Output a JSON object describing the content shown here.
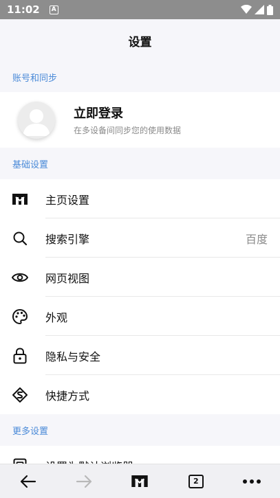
{
  "status_bar": {
    "time": "11:02",
    "notification_letter": "A"
  },
  "app_bar": {
    "title": "设置"
  },
  "sections": {
    "account": {
      "header": "账号和同步",
      "login": "立即登录",
      "subtitle": "在多设备间同步您的使用数据"
    },
    "basic": {
      "header": "基础设置",
      "items": [
        {
          "label": "主页设置",
          "value": "",
          "icon": "home-logo-icon"
        },
        {
          "label": "搜索引擎",
          "value": "百度",
          "icon": "search-icon"
        },
        {
          "label": "网页视图",
          "value": "",
          "icon": "eye-icon"
        },
        {
          "label": "外观",
          "value": "",
          "icon": "palette-icon"
        },
        {
          "label": "隐私与安全",
          "value": "",
          "icon": "lock-icon"
        },
        {
          "label": "快捷方式",
          "value": "",
          "icon": "shortcut-icon"
        }
      ]
    },
    "more": {
      "header": "更多设置",
      "items": [
        {
          "label": "设置为默认浏览器",
          "icon": "default-browser-icon"
        }
      ]
    }
  },
  "bottom_bar": {
    "tab_count": "2"
  }
}
